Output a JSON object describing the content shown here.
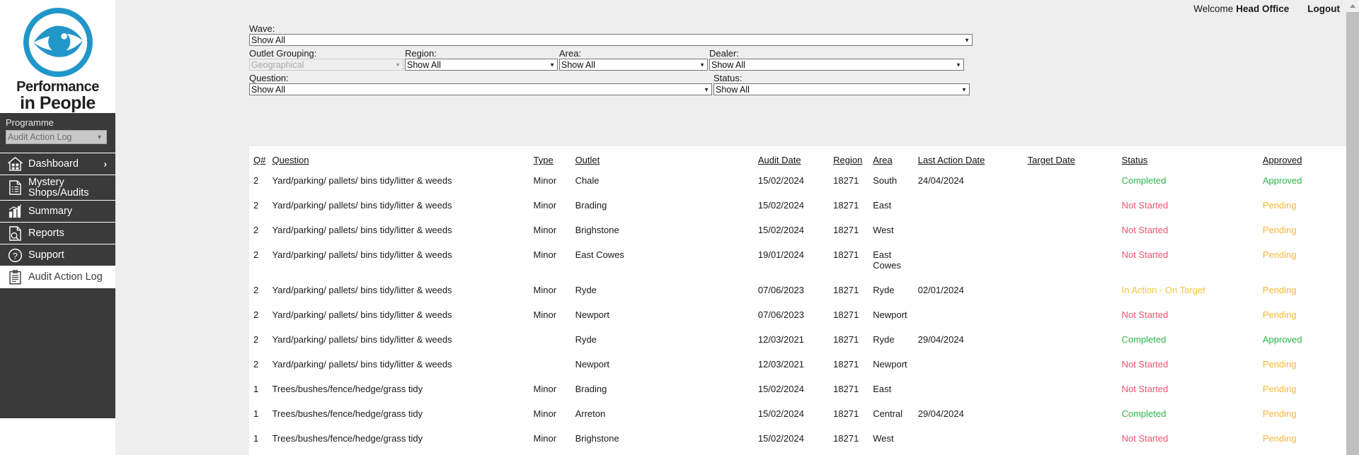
{
  "topbar": {
    "welcome_label": "Welcome",
    "user_name": "Head Office",
    "logout_label": "Logout"
  },
  "branding": {
    "line1": "Performance",
    "line2": "in People",
    "logo_color": "#2196c8",
    "wordmark_color": "#231f20"
  },
  "sidebar": {
    "programme_label": "Programme",
    "programme_value": "Audit Action Log",
    "items": [
      {
        "label": "Dashboard",
        "icon": "house-grid-icon",
        "chevron": "›",
        "active": false
      },
      {
        "label": "Mystery Shops/Audits",
        "icon": "document-checklist-icon",
        "chevron": "",
        "active": false
      },
      {
        "label": "Summary",
        "icon": "bar-chart-icon",
        "chevron": "",
        "active": false
      },
      {
        "label": "Reports",
        "icon": "document-search-icon",
        "chevron": "",
        "active": false
      },
      {
        "label": "Support",
        "icon": "question-circle-icon",
        "chevron": "",
        "active": false
      },
      {
        "label": "Audit Action Log",
        "icon": "clipboard-icon",
        "chevron": "",
        "active": true
      }
    ]
  },
  "filters": {
    "wave": {
      "label": "Wave:",
      "value": "Show All"
    },
    "outlet_grouping": {
      "label": "Outlet Grouping:",
      "value": "Geographical",
      "disabled": true
    },
    "region": {
      "label": "Region:",
      "value": "Show All"
    },
    "area": {
      "label": "Area:",
      "value": "Show All"
    },
    "dealer": {
      "label": "Dealer:",
      "value": "Show All"
    },
    "question": {
      "label": "Question:",
      "value": "Show All"
    },
    "status": {
      "label": "Status:",
      "value": "Show All"
    }
  },
  "table": {
    "headers": [
      "Q#",
      "Question",
      "Type",
      "Outlet",
      "Audit Date",
      "Region",
      "Area",
      "Last Action Date",
      "Target Date",
      "Status",
      "Approved"
    ],
    "rows": [
      {
        "q": "2",
        "question": "Yard/parking/ pallets/ bins tidy/litter & weeds",
        "type": "Minor",
        "outlet": "Chale",
        "audit_date": "15/02/2024",
        "region": "18271",
        "area": "South",
        "last_action_date": "24/04/2024",
        "target_date": "",
        "status": "Completed",
        "status_class": "st-completed",
        "approved": "Approved",
        "approved_class": "ap-approved"
      },
      {
        "q": "2",
        "question": "Yard/parking/ pallets/ bins tidy/litter & weeds",
        "type": "Minor",
        "outlet": "Brading",
        "audit_date": "15/02/2024",
        "region": "18271",
        "area": "East",
        "last_action_date": "",
        "target_date": "",
        "status": "Not Started",
        "status_class": "st-notstarted",
        "approved": "Pending",
        "approved_class": "ap-pending"
      },
      {
        "q": "2",
        "question": "Yard/parking/ pallets/ bins tidy/litter & weeds",
        "type": "Minor",
        "outlet": "Brighstone",
        "audit_date": "15/02/2024",
        "region": "18271",
        "area": "West",
        "last_action_date": "",
        "target_date": "",
        "status": "Not Started",
        "status_class": "st-notstarted",
        "approved": "Pending",
        "approved_class": "ap-pending"
      },
      {
        "q": "2",
        "question": "Yard/parking/ pallets/ bins tidy/litter & weeds",
        "type": "Minor",
        "outlet": "East Cowes",
        "audit_date": "19/01/2024",
        "region": "18271",
        "area": "East Cowes",
        "last_action_date": "",
        "target_date": "",
        "status": "Not Started",
        "status_class": "st-notstarted",
        "approved": "Pending",
        "approved_class": "ap-pending"
      },
      {
        "q": "2",
        "question": "Yard/parking/ pallets/ bins tidy/litter & weeds",
        "type": "Minor",
        "outlet": "Ryde",
        "audit_date": "07/06/2023",
        "region": "18271",
        "area": "Ryde",
        "last_action_date": "02/01/2024",
        "target_date": "",
        "status": "In Action - On Target",
        "status_class": "st-inaction",
        "approved": "Pending",
        "approved_class": "ap-pending"
      },
      {
        "q": "2",
        "question": "Yard/parking/ pallets/ bins tidy/litter & weeds",
        "type": "Minor",
        "outlet": "Newport",
        "audit_date": "07/06/2023",
        "region": "18271",
        "area": "Newport",
        "last_action_date": "",
        "target_date": "",
        "status": "Not Started",
        "status_class": "st-notstarted",
        "approved": "Pending",
        "approved_class": "ap-pending"
      },
      {
        "q": "2",
        "question": "Yard/parking/ pallets/ bins tidy/litter & weeds",
        "type": "",
        "outlet": "Ryde",
        "audit_date": "12/03/2021",
        "region": "18271",
        "area": "Ryde",
        "last_action_date": "29/04/2024",
        "target_date": "",
        "status": "Completed",
        "status_class": "st-completed",
        "approved": "Approved",
        "approved_class": "ap-approved"
      },
      {
        "q": "2",
        "question": "Yard/parking/ pallets/ bins tidy/litter & weeds",
        "type": "",
        "outlet": "Newport",
        "audit_date": "12/03/2021",
        "region": "18271",
        "area": "Newport",
        "last_action_date": "",
        "target_date": "",
        "status": "Not Started",
        "status_class": "st-notstarted",
        "approved": "Pending",
        "approved_class": "ap-pending"
      },
      {
        "q": "1",
        "question": "Trees/bushes/fence/hedge/grass tidy",
        "type": "Minor",
        "outlet": "Brading",
        "audit_date": "15/02/2024",
        "region": "18271",
        "area": "East",
        "last_action_date": "",
        "target_date": "",
        "status": "Not Started",
        "status_class": "st-notstarted",
        "approved": "Pending",
        "approved_class": "ap-pending"
      },
      {
        "q": "1",
        "question": "Trees/bushes/fence/hedge/grass tidy",
        "type": "Minor",
        "outlet": "Arreton",
        "audit_date": "15/02/2024",
        "region": "18271",
        "area": "Central",
        "last_action_date": "29/04/2024",
        "target_date": "",
        "status": "Completed",
        "status_class": "st-completed",
        "approved": "Pending",
        "approved_class": "ap-pending"
      },
      {
        "q": "1",
        "question": "Trees/bushes/fence/hedge/grass tidy",
        "type": "Minor",
        "outlet": "Brighstone",
        "audit_date": "15/02/2024",
        "region": "18271",
        "area": "West",
        "last_action_date": "",
        "target_date": "",
        "status": "Not Started",
        "status_class": "st-notstarted",
        "approved": "Pending",
        "approved_class": "ap-pending"
      }
    ]
  },
  "scrollbar": {
    "up_arrow": "scroll-up-arrow"
  }
}
